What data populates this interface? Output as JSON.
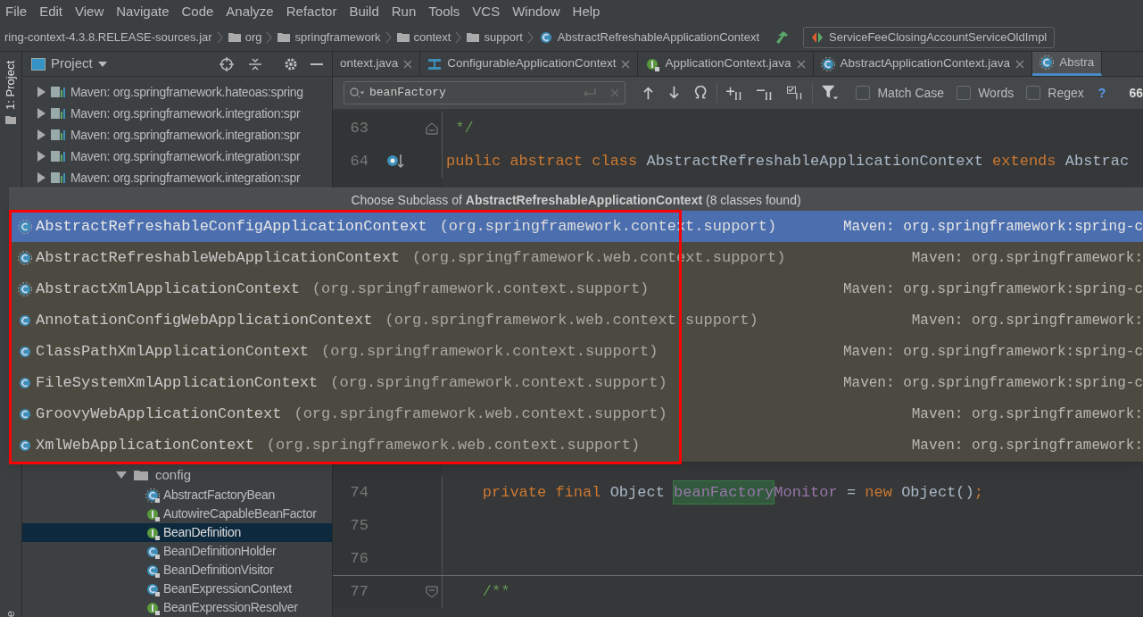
{
  "menu": [
    "File",
    "Edit",
    "View",
    "Navigate",
    "Code",
    "Analyze",
    "Refactor",
    "Build",
    "Run",
    "Tools",
    "VCS",
    "Window",
    "Help"
  ],
  "breadcrumbs": [
    {
      "label": "ring-context-4.3.8.RELEASE-sources.jar",
      "kind": "jar"
    },
    {
      "label": "org",
      "kind": "folder"
    },
    {
      "label": "springframework",
      "kind": "folder"
    },
    {
      "label": "context",
      "kind": "folder"
    },
    {
      "label": "support",
      "kind": "folder"
    },
    {
      "label": "AbstractRefreshableApplicationContext",
      "kind": "class"
    }
  ],
  "run_config": "ServiceFeeClosingAccountServiceOldImpl",
  "tool_stripe": {
    "top": "1: Project",
    "bottom": "e"
  },
  "project_panel": {
    "title": "Project",
    "upper_rows": [
      {
        "label": "Maven: org.springframework.hateoas:spring",
        "expanded": false
      },
      {
        "label": "Maven: org.springframework.integration:spr",
        "expanded": false
      },
      {
        "label": "Maven: org.springframework.integration:spr",
        "expanded": false
      },
      {
        "label": "Maven: org.springframework.integration:spr",
        "expanded": false
      },
      {
        "label": "Maven: org.springframework.integration:spr",
        "expanded": false
      }
    ],
    "lower_rows": [
      {
        "label": "config",
        "expanded": true,
        "children": [
          {
            "label": "AbstractFactoryBean",
            "kind": "abstract",
            "selected": false
          },
          {
            "label": "AutowireCapableBeanFactor",
            "kind": "interface",
            "selected": false
          },
          {
            "label": "BeanDefinition",
            "kind": "interface",
            "selected": true
          },
          {
            "label": "BeanDefinitionHolder",
            "kind": "class",
            "selected": false
          },
          {
            "label": "BeanDefinitionVisitor",
            "kind": "class",
            "selected": false
          },
          {
            "label": "BeanExpressionContext",
            "kind": "class",
            "selected": false
          },
          {
            "label": "BeanExpressionResolver",
            "kind": "interface",
            "selected": false
          }
        ]
      }
    ]
  },
  "editor_tabs": [
    {
      "label": "ontext.java",
      "kind": "none",
      "selected": false
    },
    {
      "label": "ConfigurableApplicationContext",
      "kind": "configurable",
      "selected": false
    },
    {
      "label": "ApplicationContext.java",
      "kind": "interface",
      "selected": false
    },
    {
      "label": "AbstractApplicationContext.java",
      "kind": "abstract",
      "selected": false
    },
    {
      "label": "Abstra",
      "kind": "abstract",
      "selected": true
    }
  ],
  "find_bar": {
    "query": "beanFactory",
    "options": [
      {
        "label": "Match Case",
        "checked": false
      },
      {
        "label": "Words",
        "checked": false
      },
      {
        "label": "Regex",
        "checked": false
      }
    ],
    "help": "?",
    "count": "66"
  },
  "code_upper": [
    {
      "number": "63",
      "kind": "fold-end",
      "tokens": [
        {
          "text": " */",
          "kind": "comment"
        }
      ]
    },
    {
      "number": "64",
      "kind": "implemented",
      "tokens": [
        {
          "text": "public abstract class ",
          "kind": "keyword"
        },
        {
          "text": "AbstractRefreshableApplicationContext ",
          "kind": "plain"
        },
        {
          "text": "extends ",
          "kind": "keyword"
        },
        {
          "text": "Abstrac",
          "kind": "plain"
        }
      ]
    }
  ],
  "code_lower": [
    {
      "number": "74",
      "kind": "plain",
      "tokens": [
        {
          "text": "    private final ",
          "kind": "keyword"
        },
        {
          "text": "Object ",
          "kind": "plain"
        },
        {
          "text": "beanFactory",
          "kind": "match"
        },
        {
          "text": "Monitor",
          "kind": "field"
        },
        {
          "text": " = ",
          "kind": "plain"
        },
        {
          "text": "new ",
          "kind": "keyword"
        },
        {
          "text": "Object()",
          "kind": "plain"
        },
        {
          "text": ";",
          "kind": "keyword"
        }
      ]
    },
    {
      "number": "75",
      "kind": "plain"
    },
    {
      "number": "76",
      "kind": "plain"
    },
    {
      "number": "77",
      "kind": "fold-start",
      "tokens": [
        {
          "text": "    /**",
          "kind": "comment"
        }
      ]
    }
  ],
  "popup": {
    "title": "Choose Subclass of **AbstractRefreshableApplicationContext** (8 classes found)",
    "rows": [
      {
        "name": "AbstractRefreshableConfigApplicationContext",
        "package": "(org.springframework.context.support)",
        "module": "Maven: org.springframework:spring-c",
        "kind": "abstract",
        "selected": true
      },
      {
        "name": "AbstractRefreshableWebApplicationContext",
        "package": "(org.springframework.web.context.support)",
        "module": "Maven: org.springframework:",
        "kind": "abstract",
        "selected": false
      },
      {
        "name": "AbstractXmlApplicationContext",
        "package": "(org.springframework.context.support)",
        "module": "Maven: org.springframework:spring-c",
        "kind": "abstract",
        "selected": false
      },
      {
        "name": "AnnotationConfigWebApplicationContext",
        "package": "(org.springframework.web.context.support)",
        "module": "Maven: org.springframework:",
        "kind": "class",
        "selected": false
      },
      {
        "name": "ClassPathXmlApplicationContext",
        "package": "(org.springframework.context.support)",
        "module": "Maven: org.springframework:spring-c",
        "kind": "class",
        "selected": false
      },
      {
        "name": "FileSystemXmlApplicationContext",
        "package": "(org.springframework.context.support)",
        "module": "Maven: org.springframework:spring-c",
        "kind": "class",
        "selected": false
      },
      {
        "name": "GroovyWebApplicationContext",
        "package": "(org.springframework.web.context.support)",
        "module": "Maven: org.springframework:",
        "kind": "class",
        "selected": false
      },
      {
        "name": "XmlWebApplicationContext",
        "package": "(org.springframework.web.context.support)",
        "module": "Maven: org.springframework:",
        "kind": "class",
        "selected": false
      }
    ]
  }
}
